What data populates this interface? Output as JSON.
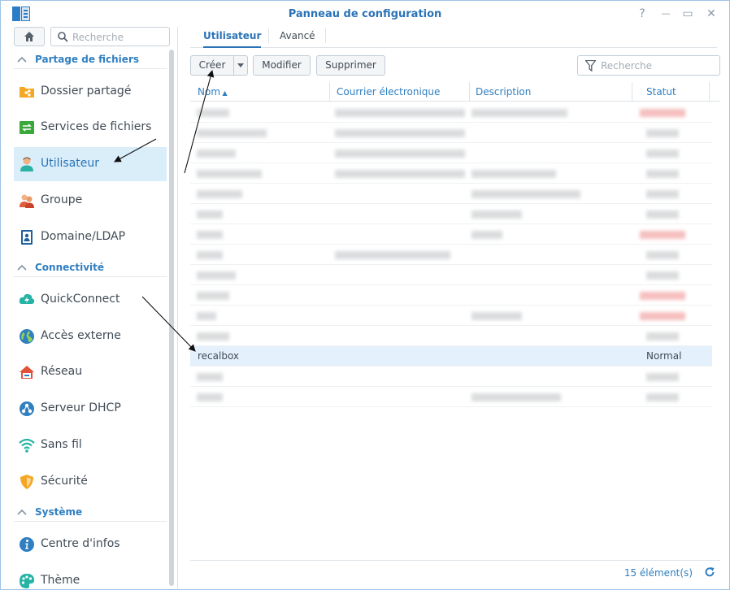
{
  "window": {
    "title": "Panneau de configuration",
    "controls": {
      "help": "?",
      "minimize": "—",
      "maximize": "▭",
      "close": "✕"
    }
  },
  "sidebar": {
    "search_placeholder": "Recherche",
    "sections": [
      {
        "label": "Partage de fichiers"
      },
      {
        "label": "Connectivité"
      },
      {
        "label": "Système"
      }
    ],
    "items": [
      {
        "label": "Dossier partagé",
        "icon": "shared-folder-icon"
      },
      {
        "label": "Services de fichiers",
        "icon": "file-services-icon"
      },
      {
        "label": "Utilisateur",
        "icon": "user-icon"
      },
      {
        "label": "Groupe",
        "icon": "group-icon"
      },
      {
        "label": "Domaine/LDAP",
        "icon": "domain-ldap-icon"
      },
      {
        "label": "QuickConnect",
        "icon": "quickconnect-icon"
      },
      {
        "label": "Accès externe",
        "icon": "external-access-icon"
      },
      {
        "label": "Réseau",
        "icon": "network-icon"
      },
      {
        "label": "Serveur DHCP",
        "icon": "dhcp-server-icon"
      },
      {
        "label": "Sans fil",
        "icon": "wireless-icon"
      },
      {
        "label": "Sécurité",
        "icon": "security-icon"
      },
      {
        "label": "Centre d'infos",
        "icon": "info-center-icon"
      },
      {
        "label": "Thème",
        "icon": "theme-icon"
      }
    ],
    "active_item": "Utilisateur"
  },
  "main": {
    "tabs": [
      {
        "label": "Utilisateur",
        "active": true
      },
      {
        "label": "Avancé",
        "active": false
      }
    ],
    "toolbar": {
      "create": "Créer",
      "modify": "Modifier",
      "delete": "Supprimer",
      "search_placeholder": "Recherche"
    },
    "columns": [
      "Nom",
      "Courrier électronique",
      "Description",
      "Statut"
    ],
    "visible_row": {
      "name": "recalbox",
      "status": "Normal"
    },
    "footer": {
      "count": "15 élément(s)"
    }
  },
  "colors": {
    "accent": "#2a73b8",
    "selected_row": "#e4f0fb",
    "active_sidebar": "#daeefa",
    "disabled_status": "#f5b8b8"
  }
}
